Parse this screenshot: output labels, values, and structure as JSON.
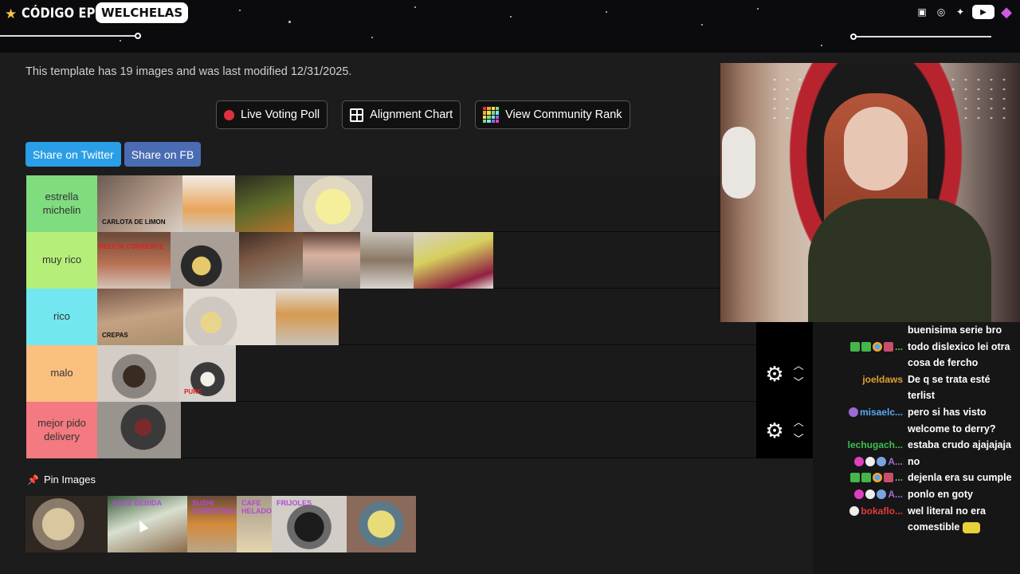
{
  "overlay": {
    "brand": "CÓDIGO EPIC",
    "channel": "WELCHELAS",
    "socials": [
      "twitch-icon",
      "instagram-icon",
      "twitter-icon",
      "youtube-icon",
      "gem-icon"
    ]
  },
  "page": {
    "info_text": "This template has 19 images and was last modified 12/31/2025.",
    "buttons": {
      "live_poll": "Live Voting Poll",
      "alignment": "Alignment Chart",
      "community": "View Community Rank"
    },
    "share": {
      "twitter": "Share on Twitter",
      "facebook": "Share on FB"
    },
    "pin_label": "Pin Images"
  },
  "tiers": [
    {
      "label": "estrella michelin",
      "color": "#7fdc7f",
      "thumbs": [
        {
          "w": 107,
          "bg": "linear-gradient(135deg,#6b5b52,#b59c8a 60%,#d8cfc5)",
          "caption": "CARLOTA DE LIMON"
        },
        {
          "w": 66,
          "bg": "linear-gradient(180deg,#f2ece6,#e9a65c 60%,#cfcac4)"
        },
        {
          "w": 74,
          "bg": "linear-gradient(160deg,#2a2a20,#5b6a2a 50%,#b5732f)"
        },
        {
          "w": 98,
          "bg": "radial-gradient(circle at 50% 55%,#f5ef9c 0 35%,#e0d8c0 36% 60%,#c7c2bb 61%)"
        }
      ]
    },
    {
      "label": "muy rico",
      "color": "#b5ef79",
      "thumbs": [
        {
          "w": 92,
          "bg": "linear-gradient(180deg,#6b4a3a,#b86f52 55%,#d3c4b8)",
          "caption": "RECETA CORRIENTE",
          "caption_style": "red"
        },
        {
          "w": 86,
          "bg": "radial-gradient(circle at 45% 60%,#e7c86a 0 18%,#2a2a2a 19% 40%,#a99f96 41%)"
        },
        {
          "w": 80,
          "bg": "linear-gradient(160deg,#3b2b22,#7c5a45 40%,#9a9289)"
        },
        {
          "w": 72,
          "bg": "linear-gradient(180deg,#5a3b2f,#d8b2a1 40%,#8c857c)"
        },
        {
          "w": 67,
          "bg": "linear-gradient(180deg,#c7c2ba,#8a7865 50%,#d9d4cf)"
        },
        {
          "w": 100,
          "bg": "linear-gradient(160deg,#d8d2c8,#d6cf5e 40%,#8f2040 80%,#e6e2de)"
        }
      ]
    },
    {
      "label": "rico",
      "color": "#73e7f0",
      "thumbs": [
        {
          "w": 108,
          "bg": "linear-gradient(170deg,#7a5b4a,#c5a184 50%,#aa8f6a)",
          "caption": "CREPAS"
        },
        {
          "w": 116,
          "bg": "radial-gradient(circle at 30% 60%,#e9d58a 0 14%,#cfc8c0 15% 35%,#e3ddd6 36%)"
        },
        {
          "w": 79,
          "bg": "linear-gradient(180deg,#e2ddd7,#d59a4f 45%,#c8c1b8)"
        }
      ]
    },
    {
      "label": "malo",
      "color": "#fbbf80",
      "thumbs": [
        {
          "w": 103,
          "bg": "radial-gradient(circle at 45% 55%,#3a2a22 0 20%,#8a8580 21% 40%,#d3cdc6 41%)"
        },
        {
          "w": 71,
          "bg": "radial-gradient(circle at 50% 60%,#f2efe5 0 16%,#3a3a3a 17% 38%,#d8d2cc 39%)",
          "caption": "PURE",
          "caption_style": "red-bottom"
        }
      ]
    },
    {
      "label": "mejor pido delivery",
      "color": "#f27a80",
      "thumbs": [
        {
          "w": 105,
          "bg": "radial-gradient(circle at 55% 45%,#7a2a2a 0 15%,#3a3a3a 16% 40%,#9a948e 41%)"
        }
      ]
    }
  ],
  "pinned": [
    {
      "w": 103,
      "bg": "radial-gradient(circle at 40% 50%,#d9c7a0 0 28%,#8a7a6a 29% 45%,#2f2722 46%)"
    },
    {
      "w": 100,
      "bg": "linear-gradient(160deg,#3a5a3a,#d8e0d0 45%,#8a6a4a)",
      "caption": "SAKE BEBIDA"
    },
    {
      "w": 62,
      "bg": "linear-gradient(180deg,#6a4a3a,#d48a3a 50%,#b8a58a)",
      "caption": "SUSHI COMESTIBLE"
    },
    {
      "w": 44,
      "bg": "linear-gradient(180deg,#a89c8a,#e5d5b0)",
      "caption": "CAFE HELADO"
    },
    {
      "w": 94,
      "bg": "radial-gradient(circle at 50% 55%,#1c1c1c 0 30%,#6a6a6a 31% 45%,#d2cdc6 46%)",
      "caption": "FRIJOLES"
    },
    {
      "w": 87,
      "bg": "radial-gradient(circle at 50% 50%,#e8dc7a 0 30%,#5a7a8a 31% 50%,#8a6a5a 51%)"
    }
  ],
  "chat": [
    {
      "user": "",
      "user_color": "#fff",
      "badges": [],
      "text": "buenisima serie bro"
    },
    {
      "user": "...",
      "user_color": "#6ac15a",
      "badges": [
        "b-green",
        "b-green",
        "b-globe",
        "b-x"
      ],
      "text": "todo dislexico lei otra cosa de fercho"
    },
    {
      "user": "joeldaws",
      "user_color": "#e0a030",
      "badges": [],
      "text": "De q se trata esté terlist"
    },
    {
      "user": "misaelc...",
      "user_color": "#5aa8f0",
      "badges": [
        "b-purple"
      ],
      "text": "pero si has visto welcome to derry?"
    },
    {
      "user": "lechugach...",
      "user_color": "#3fbf50",
      "badges": [],
      "text": "estaba crudo ajajajaja"
    },
    {
      "user": "A...",
      "user_color": "#a56ad8",
      "badges": [
        "b-heart",
        "b-skull",
        "b-cloud"
      ],
      "text": "no"
    },
    {
      "user": "...",
      "user_color": "#6ac15a",
      "badges": [
        "b-green",
        "b-green",
        "b-globe",
        "b-x"
      ],
      "text": "dejenla era su cumple"
    },
    {
      "user": "A...",
      "user_color": "#a56ad8",
      "badges": [
        "b-heart",
        "b-skull",
        "b-cloud"
      ],
      "text": "ponlo en goty"
    },
    {
      "user": "bokaflo...",
      "user_color": "#e03a3a",
      "badges": [
        "b-skull"
      ],
      "text": "wel literal no era comestible"
    }
  ]
}
